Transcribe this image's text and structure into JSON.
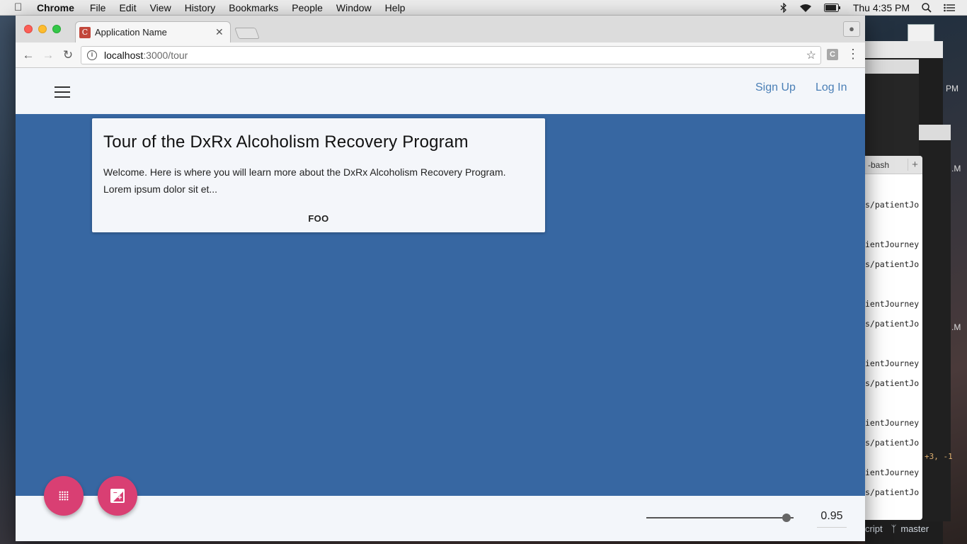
{
  "menubar": {
    "app": "Chrome",
    "items": [
      "File",
      "Edit",
      "View",
      "History",
      "Bookmarks",
      "People",
      "Window",
      "Help"
    ],
    "clock": "Thu 4:35 PM"
  },
  "browser": {
    "tab_title": "Application Name",
    "favicon_letter": "C",
    "url_host": "localhost",
    "url_path": ":3000/tour",
    "extension_letter": "C"
  },
  "app": {
    "signup_label": "Sign Up",
    "login_label": "Log In",
    "card": {
      "title": "Tour of the DxRx Alcoholism Recovery Program",
      "body": "Welcome. Here is where you will learn more about the DxRx Alcoholism Recovery Program. Lorem ipsum dolor sit et...",
      "action_label": "FOO"
    },
    "slider": {
      "value": 0.95,
      "value_label": "0.95"
    },
    "colors": {
      "stage": "#3767a2",
      "fab": "#d93f73",
      "link": "#4a7fb6"
    }
  },
  "terminal": {
    "tab_label": "-bash",
    "lines": [
      "s/patientJo",
      "ientJourney",
      "s/patientJo",
      "ientJourney",
      "s/patientJo",
      "ientJourney",
      "s/patientJo",
      "ientJourney",
      "s/patientJo",
      "ientJourney",
      "s/patientJo"
    ],
    "diffstat": "+3, -1",
    "status_left": "cript",
    "branch": "master",
    "clipped_pm": "PM",
    "clipped_m": ".M"
  }
}
